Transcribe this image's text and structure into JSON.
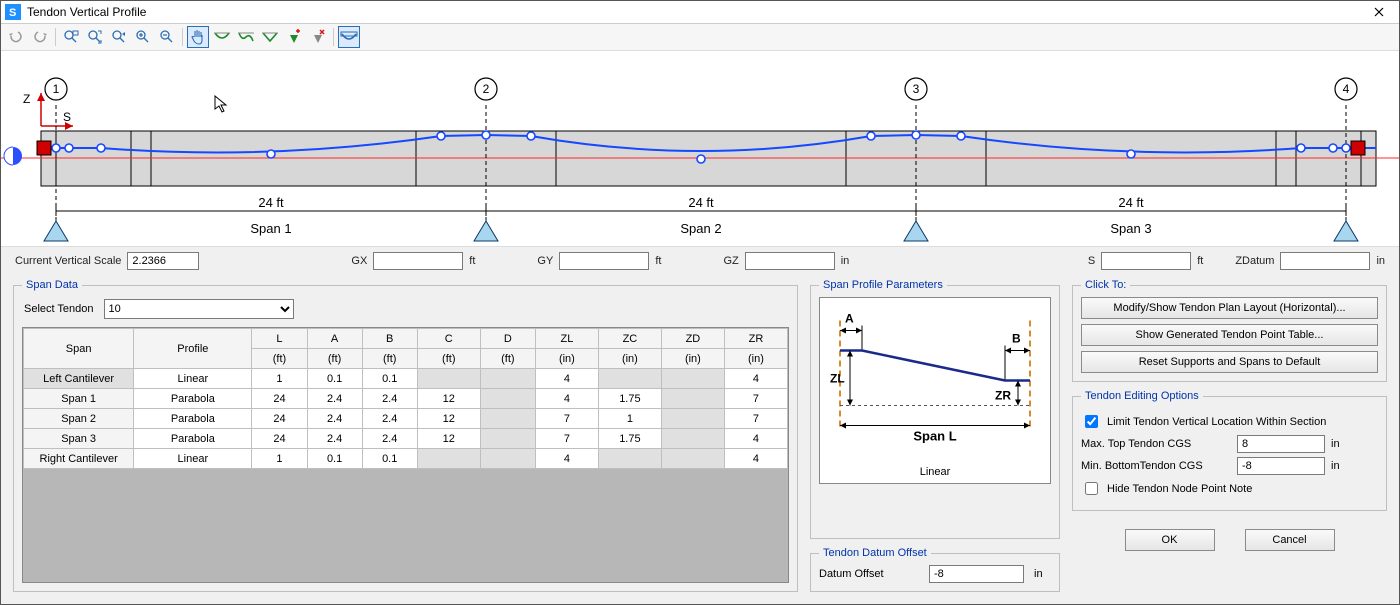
{
  "window": {
    "title": "Tendon Vertical Profile"
  },
  "controls_row": {
    "scale_label": "Current Vertical Scale",
    "scale_value": "2.2366",
    "gx_label": "GX",
    "gx_value": "",
    "gx_unit": "ft",
    "gy_label": "GY",
    "gy_value": "",
    "gy_unit": "ft",
    "gz_label": "GZ",
    "gz_value": "",
    "gz_unit": "in",
    "s_label": "S",
    "s_value": "",
    "s_unit": "ft",
    "zd_label": "ZDatum",
    "zd_value": "",
    "zd_unit": "in"
  },
  "profile": {
    "axis_z": "Z",
    "axis_s": "S",
    "nodes": [
      "1",
      "2",
      "3",
      "4"
    ],
    "span_len": "24 ft",
    "span_names": [
      "Span 1",
      "Span 2",
      "Span 3"
    ]
  },
  "span_data": {
    "legend": "Span Data",
    "select_label": "Select Tendon",
    "select_value": "10",
    "headers": {
      "span": "Span",
      "profile": "Profile",
      "L": "L",
      "L2": "(ft)",
      "A": "A",
      "A2": "(ft)",
      "B": "B",
      "B2": "(ft)",
      "C": "C",
      "C2": "(ft)",
      "D": "D",
      "D2": "(ft)",
      "ZL": "ZL",
      "ZL2": "(in)",
      "ZC": "ZC",
      "ZC2": "(in)",
      "ZD": "ZD",
      "ZD2": "(in)",
      "ZR": "ZR",
      "ZR2": "(in)"
    },
    "rows": [
      {
        "span": "Left Cantilever",
        "profile": "Linear",
        "L": "1",
        "A": "0.1",
        "B": "0.1",
        "C": "",
        "D": "",
        "ZL": "4",
        "ZC": "",
        "ZD": "",
        "ZR": "4",
        "shadeSpan": true,
        "shadeC": true,
        "shadeD": true,
        "shadeZC": true,
        "shadeZD": true
      },
      {
        "span": "Span 1",
        "profile": "Parabola",
        "L": "24",
        "A": "2.4",
        "B": "2.4",
        "C": "12",
        "D": "",
        "ZL": "4",
        "ZC": "1.75",
        "ZD": "",
        "ZR": "7",
        "shadeD": true,
        "shadeZD": true
      },
      {
        "span": "Span 2",
        "profile": "Parabola",
        "L": "24",
        "A": "2.4",
        "B": "2.4",
        "C": "12",
        "D": "",
        "ZL": "7",
        "ZC": "1",
        "ZD": "",
        "ZR": "7",
        "shadeD": true,
        "shadeZD": true
      },
      {
        "span": "Span 3",
        "profile": "Parabola",
        "L": "24",
        "A": "2.4",
        "B": "2.4",
        "C": "12",
        "D": "",
        "ZL": "7",
        "ZC": "1.75",
        "ZD": "",
        "ZR": "4",
        "shadeD": true,
        "shadeZD": true
      },
      {
        "span": "Right Cantilever",
        "profile": "Linear",
        "L": "1",
        "A": "0.1",
        "B": "0.1",
        "C": "",
        "D": "",
        "ZL": "4",
        "ZC": "",
        "ZD": "",
        "ZR": "4",
        "shadeC": true,
        "shadeD": true,
        "shadeZC": true,
        "shadeZD": true
      }
    ]
  },
  "span_profile": {
    "legend": "Span Profile Parameters",
    "caption": "Linear",
    "lbl_A": "A",
    "lbl_B": "B",
    "lbl_ZL": "ZL",
    "lbl_ZR": "ZR",
    "lbl_SpanL": "Span L"
  },
  "datum": {
    "legend": "Tendon Datum Offset",
    "label": "Datum Offset",
    "value": "-8",
    "unit": "in"
  },
  "click_to": {
    "legend": "Click To:",
    "btn1": "Modify/Show Tendon Plan Layout (Horizontal)...",
    "btn2": "Show Generated Tendon Point Table...",
    "btn3": "Reset Supports and Spans to Default"
  },
  "editing": {
    "legend": "Tendon Editing Options",
    "chk_limit": "Limit Tendon Vertical Location Within Section",
    "max_label": "Max. Top Tendon CGS",
    "max_value": "8",
    "max_unit": "in",
    "min_label": "Min. BottomTendon CGS",
    "min_value": "-8",
    "min_unit": "in",
    "chk_hide": "Hide Tendon Node Point Note"
  },
  "actions": {
    "ok": "OK",
    "cancel": "Cancel"
  }
}
